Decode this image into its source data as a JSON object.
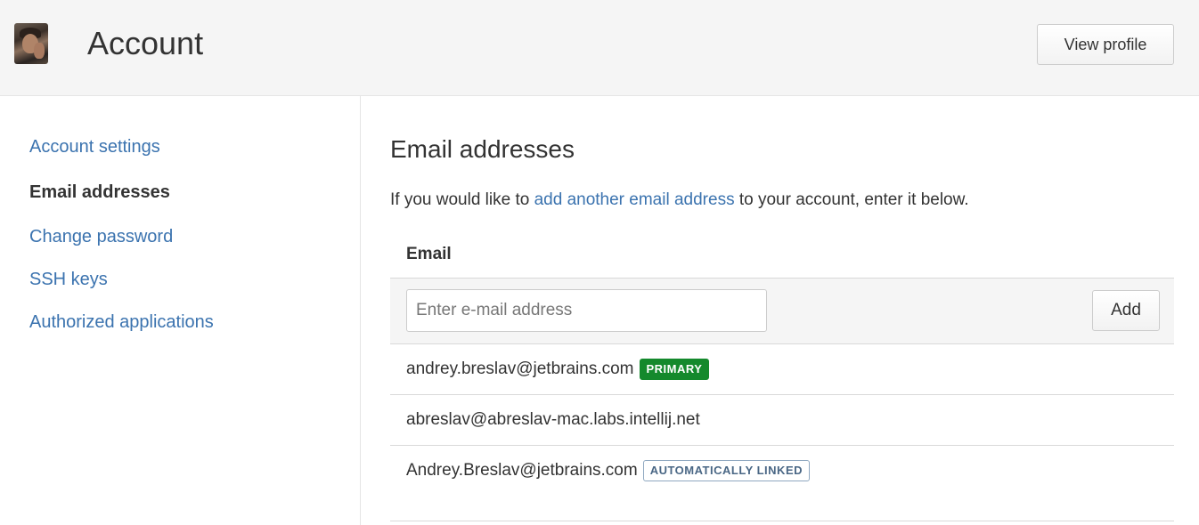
{
  "header": {
    "title": "Account",
    "view_profile_label": "View profile"
  },
  "sidebar": {
    "items": [
      {
        "label": "Account settings",
        "active": false
      },
      {
        "label": "Email addresses",
        "active": true
      },
      {
        "label": "Change password",
        "active": false
      },
      {
        "label": "SSH keys",
        "active": false
      },
      {
        "label": "Authorized applications",
        "active": false
      }
    ]
  },
  "main": {
    "section_title": "Email addresses",
    "intro_before": "If you would like to ",
    "intro_link": "add another email address",
    "intro_after": " to your account, enter it below.",
    "column_header": "Email",
    "input_placeholder": "Enter e-mail address",
    "add_label": "Add",
    "emails": [
      {
        "address": "andrey.breslav@jetbrains.com",
        "badge": "PRIMARY"
      },
      {
        "address": "abreslav@abreslav-mac.labs.intellij.net",
        "badge": ""
      },
      {
        "address": "Andrey.Breslav@jetbrains.com",
        "badge": "AUTOMATICALLY LINKED"
      }
    ]
  },
  "colors": {
    "link": "#3b73af",
    "primary_badge": "#14892c",
    "linked_badge_text": "#4a6785"
  }
}
